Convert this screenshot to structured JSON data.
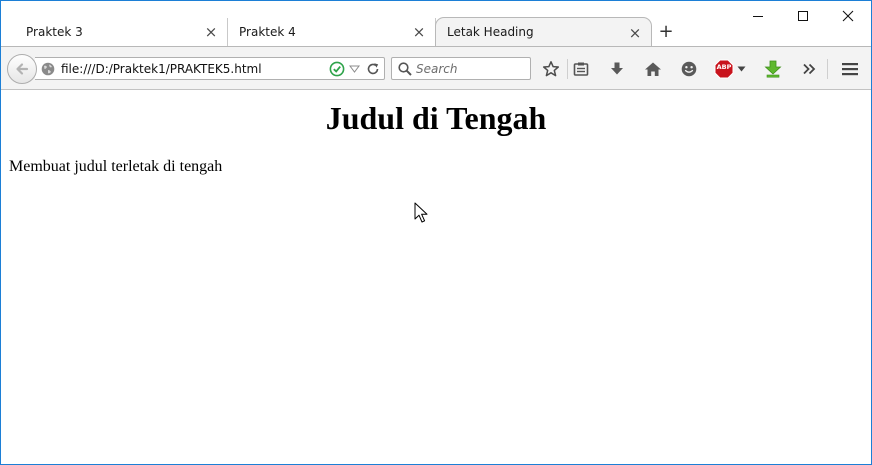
{
  "browser": {
    "tabs": [
      {
        "label": "Praktek 3",
        "close_icon": "close-icon",
        "active": false
      },
      {
        "label": "Praktek 4",
        "close_icon": "close-icon",
        "active": false
      },
      {
        "label": "Letak Heading",
        "close_icon": "close-icon",
        "active": true
      }
    ],
    "new_tab_icon": "plus-icon",
    "window_controls": [
      "minimize-icon",
      "maximize-icon",
      "close-icon"
    ]
  },
  "toolbar": {
    "back_icon": "back-arrow-icon",
    "site_identity_icon": "globe-icon",
    "url": "file:///D:/Praktek1/PRAKTEK5.html",
    "url_status_icon": "check-circle-icon",
    "reload_icon": "reload-icon",
    "search_placeholder": "Search",
    "icons": [
      "star-icon",
      "reader-list-icon",
      "download-icon",
      "home-icon",
      "smiley-icon",
      "adblock-icon",
      "green-download-icon",
      "overflow-chevron-icon",
      "hamburger-menu-icon"
    ],
    "adblock_label": "ABP"
  },
  "colors": {
    "window_border": "#1c7fd6",
    "toolbar_bg": "#f3f3f3",
    "adblock_red": "#c8131c",
    "check_green": "#2ea34a",
    "download_green": "#5eb82e"
  },
  "page": {
    "heading": "Judul di Tengah",
    "paragraph": "Membuat judul terletak di tengah"
  }
}
